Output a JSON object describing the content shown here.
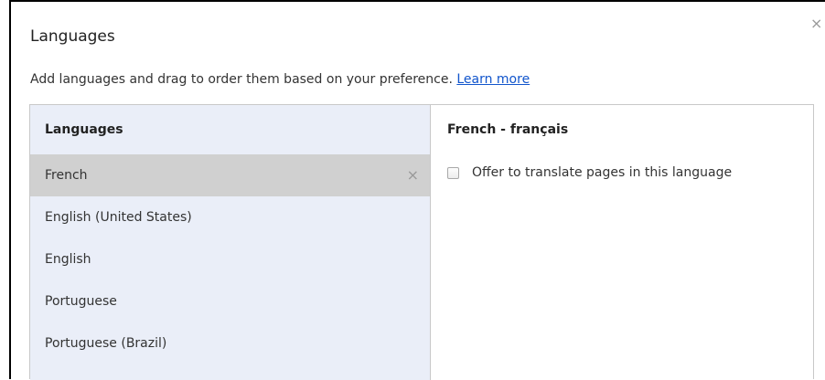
{
  "dialog": {
    "title": "Languages",
    "close_glyph": "×",
    "description": "Add languages and drag to order them based on your preference.",
    "learn_more": "Learn more"
  },
  "list": {
    "header": "Languages",
    "items": [
      {
        "label": "French",
        "selected": true,
        "remove_glyph": "×"
      },
      {
        "label": "English (United States)",
        "selected": false
      },
      {
        "label": "English",
        "selected": false
      },
      {
        "label": "Portuguese",
        "selected": false
      },
      {
        "label": "Portuguese (Brazil)",
        "selected": false
      }
    ]
  },
  "detail": {
    "title": "French - français",
    "offer_translate_label": "Offer to translate pages in this language",
    "offer_translate_checked": false
  },
  "colors": {
    "list_background": "#eaeef8",
    "selected_row": "#d0d0d0",
    "link": "#1155cc"
  }
}
